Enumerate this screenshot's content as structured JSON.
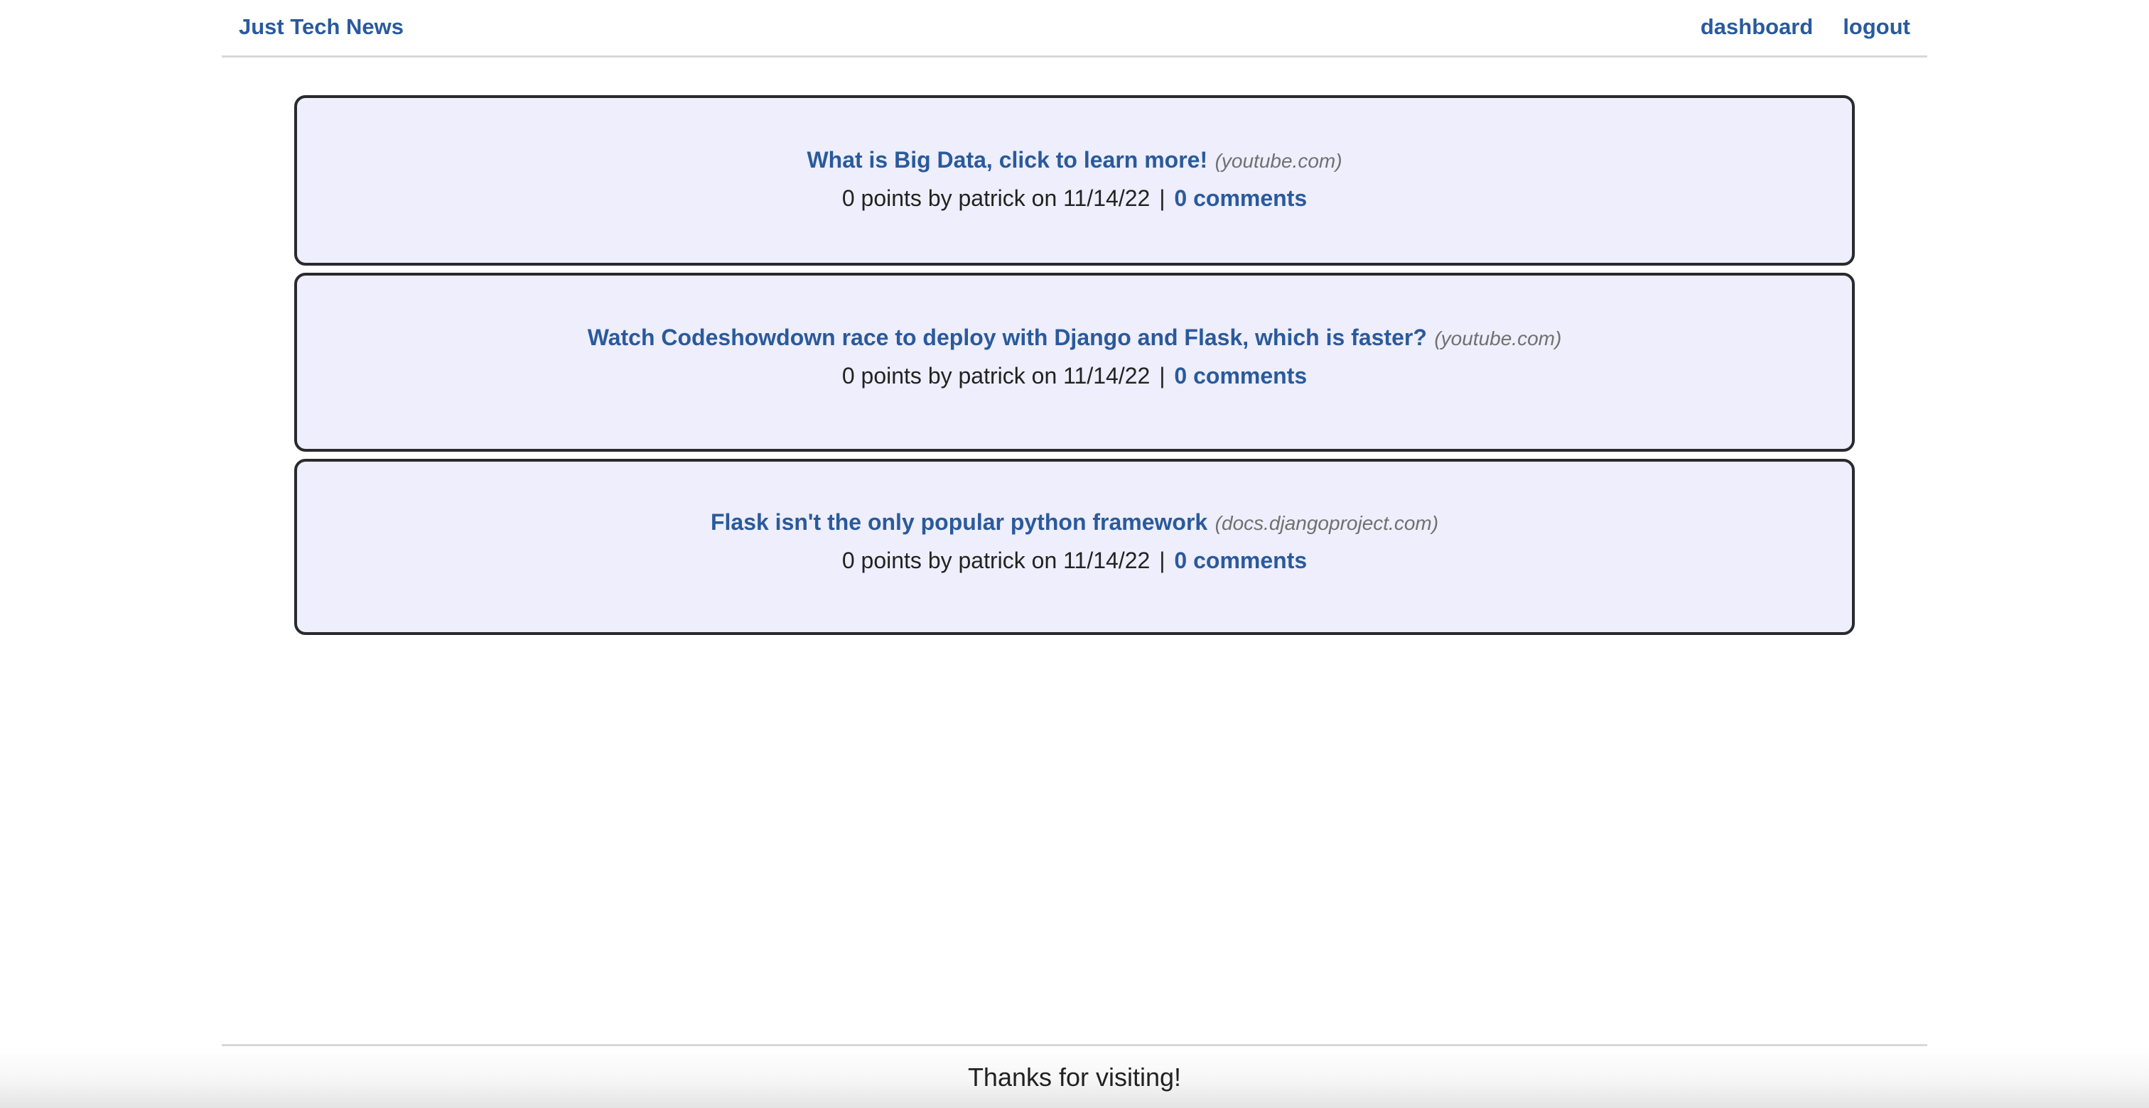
{
  "header": {
    "brand": "Just Tech News",
    "nav": {
      "dashboard": "dashboard",
      "logout": "logout"
    }
  },
  "posts": [
    {
      "title": "What is Big Data, click to learn more!",
      "domain": "(youtube.com)",
      "meta": "0 points by patrick on 11/14/22",
      "separator": "|",
      "comments": "0 comments"
    },
    {
      "title": "Watch Codeshowdown race to deploy with Django and Flask, which is faster?",
      "domain": "(youtube.com)",
      "meta": "0 points by patrick on 11/14/22",
      "separator": "|",
      "comments": "0 comments"
    },
    {
      "title": "Flask isn't the only popular python framework",
      "domain": "(docs.djangoproject.com)",
      "meta": "0 points by patrick on 11/14/22",
      "separator": "|",
      "comments": "0 comments"
    }
  ],
  "footer": {
    "text": "Thanks for visiting!"
  },
  "colors": {
    "link": "#2a5a9c",
    "card_background": "#eeeefc",
    "card_border": "#2a2a2e",
    "domain_text": "#707070",
    "rule": "#d8d8d8"
  }
}
